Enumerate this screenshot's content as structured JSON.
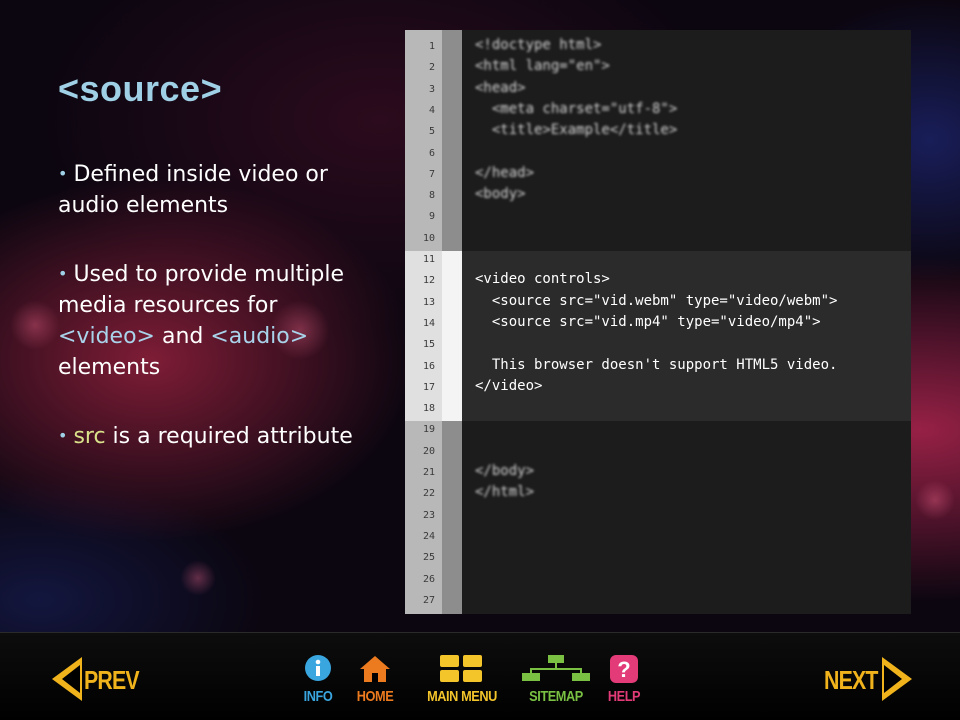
{
  "slide": {
    "title": "<source>",
    "bullets": [
      {
        "parts": [
          "Defined inside video or audio elements"
        ]
      },
      {
        "parts": [
          "Used to provide multiple media resources for ",
          "<video>",
          " and ",
          "<audio>",
          " elements"
        ]
      },
      {
        "parts": [
          "src",
          " is a required attribute"
        ]
      }
    ]
  },
  "code": {
    "line_numbers": [
      "1",
      "2",
      "3",
      "4",
      "5",
      "6",
      "7",
      "8",
      "9",
      "10",
      "11",
      "12",
      "13",
      "14",
      "15",
      "16",
      "17",
      "18",
      "19",
      "20",
      "21",
      "22",
      "23",
      "24",
      "25",
      "26",
      "27"
    ],
    "lines": [
      "<!doctype html>",
      "<html lang=\"en\">",
      "<head>",
      "  <meta charset=\"utf-8\">",
      "  <title>Example</title>",
      "",
      "</head>",
      "<body>",
      "",
      "",
      "",
      "<video controls>",
      "  <source src=\"vid.webm\" type=\"video/webm\">",
      "  <source src=\"vid.mp4\" type=\"video/mp4\">",
      "",
      "  This browser doesn't support HTML5 video.",
      "</video>",
      "",
      "",
      "",
      "</body>",
      "</html>",
      "",
      "",
      "",
      "",
      ""
    ]
  },
  "nav": {
    "prev_label": "PREV",
    "next_label": "NEXT",
    "info_label": "INFO",
    "home_label": "HOME",
    "menu_label": "MAIN MENU",
    "sitemap_label": "SITEMAP",
    "help_label": "HELP"
  },
  "colors": {
    "title": "#9fd0e6",
    "accent_yellow": "#f1b31c",
    "info_blue": "#3aa6e0",
    "home_orange": "#ec7a1e",
    "menu_yellow": "#f3c52b",
    "sitemap_green": "#79c043",
    "help_pink": "#e23b78"
  }
}
